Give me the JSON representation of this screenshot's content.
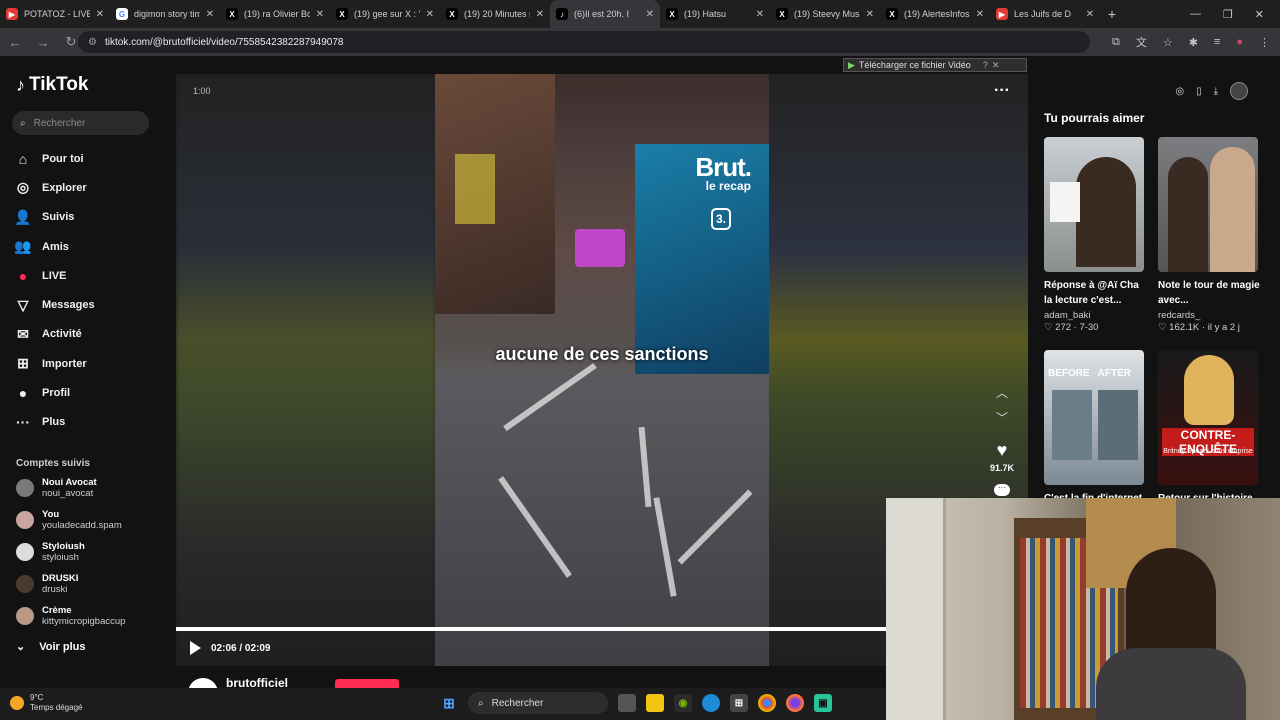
{
  "tabs": [
    {
      "title": "POTATOZ - LIVE &",
      "fav": "▶",
      "color": "#e53935",
      "active": false
    },
    {
      "title": "digimon story tim",
      "fav": "G",
      "color": "#fff",
      "active": false
    },
    {
      "title": "(19) ra Olivier Bo",
      "fav": "X",
      "color": "#000",
      "active": false
    },
    {
      "title": "(19) gee sur X : \"I",
      "fav": "X",
      "color": "#000",
      "active": false
    },
    {
      "title": "(19) 20 Minutes s",
      "fav": "X",
      "color": "#000",
      "active": false
    },
    {
      "title": "(6)Il est 20h. I",
      "fav": "♪",
      "color": "#000",
      "active": true
    },
    {
      "title": "(19) Hatsu",
      "fav": "X",
      "color": "#000",
      "active": false
    },
    {
      "title": "(19) Steevy Music",
      "fav": "X",
      "color": "#000",
      "active": false
    },
    {
      "title": "(19) AlertesInfos",
      "fav": "X",
      "color": "#000",
      "active": false
    },
    {
      "title": "Les Juifs de D",
      "fav": "▶",
      "color": "#e53935",
      "active": false
    }
  ],
  "address": "tiktok.com/@brutofficiel/video/7558542382287949078",
  "download_bar": "Télécharger ce fichier Vidéo",
  "logo": "TikTok",
  "search_placeholder": "Rechercher",
  "nav": [
    {
      "label": "Pour toi",
      "icon": "⌂",
      "name": "home-icon"
    },
    {
      "label": "Explorer",
      "icon": "◎",
      "name": "compass-icon"
    },
    {
      "label": "Suivis",
      "icon": "👤",
      "name": "following-icon"
    },
    {
      "label": "Amis",
      "icon": "👥",
      "name": "friends-icon"
    },
    {
      "label": "LIVE",
      "icon": "●",
      "name": "live-icon"
    },
    {
      "label": "Messages",
      "icon": "▽",
      "name": "messages-icon"
    },
    {
      "label": "Activité",
      "icon": "✉",
      "name": "activity-icon"
    },
    {
      "label": "Importer",
      "icon": "⊞",
      "name": "upload-icon"
    },
    {
      "label": "Profil",
      "icon": "●",
      "name": "profile-icon"
    },
    {
      "label": "Plus",
      "icon": "···",
      "name": "more-icon"
    }
  ],
  "followed_title": "Comptes suivis",
  "followed": [
    {
      "name": "Noui Avocat",
      "handle": "noui_avocat"
    },
    {
      "name": "You",
      "handle": "youladecadd.spam"
    },
    {
      "name": "Styloiush",
      "handle": "styloiush"
    },
    {
      "name": "DRUSKI",
      "handle": "druski"
    },
    {
      "name": "Crème",
      "handle": "kittymicropigbaccup"
    }
  ],
  "voir_plus": "Voir plus",
  "video": {
    "time_top": "1:00",
    "brand": "Brut.",
    "brand_sub": "le recap",
    "badge": "3.",
    "subtitle": "aucune de ces sanctions",
    "likes": "91.7K",
    "current_time": "02:06",
    "total_time": "02:09",
    "progress": 0.977
  },
  "author": "brutofficiel",
  "suggest_title": "Tu pourrais aimer",
  "suggestions": [
    {
      "title": "Réponse à @Aï Cha la lecture c'est...",
      "author": "adam_baki",
      "stats": "♡ 272 · 7-30"
    },
    {
      "title": "Note le tour de magie avec...",
      "author": "redcards_",
      "stats": "♡ 162.1K · il y a 2 j"
    },
    {
      "title": "C'est la fin d'internet",
      "overlay": "BEFORE   AFTER"
    },
    {
      "title": "Retour sur l'histoire",
      "overlay": "CONTRE-ENQUÊTE"
    }
  ],
  "card4_sub": "Britney Spears sous emprise",
  "taskbar": {
    "temp": "9°C",
    "weather": "Temps dégagé",
    "search": "Rechercher"
  }
}
